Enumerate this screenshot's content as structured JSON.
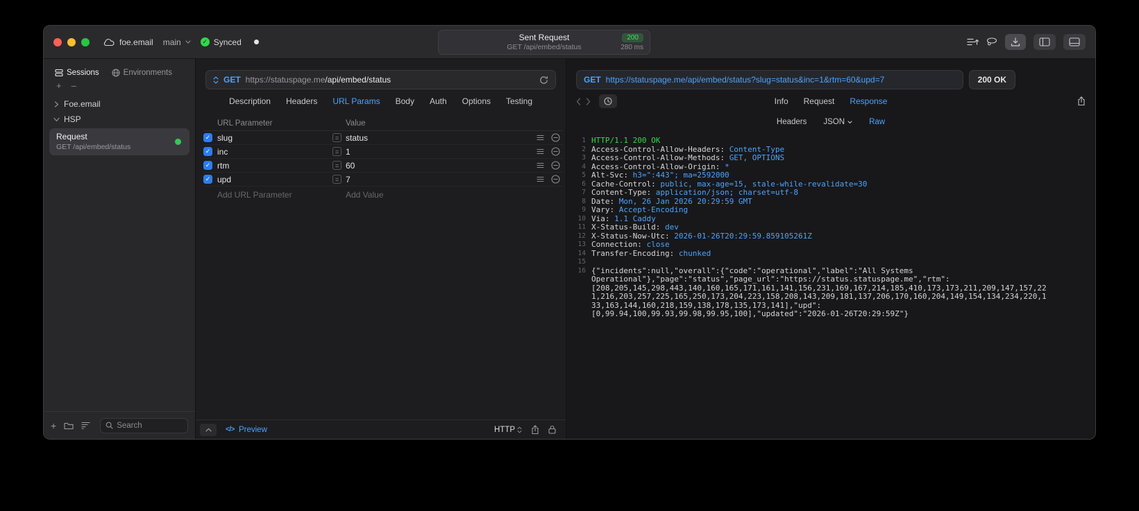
{
  "colors": {
    "accent_blue": "#4ba3ff",
    "green": "#32d74b",
    "checkbox_blue": "#2d7cf0",
    "status_dot_green": "#34c759"
  },
  "icons": {
    "plus": "+",
    "minus": "–",
    "equals": "=",
    "check": "✓",
    "code": "</>"
  },
  "titlebar": {
    "project": "foe.email",
    "branch": "main",
    "sync": "Synced",
    "center": {
      "title": "Sent Request",
      "badge": "200",
      "subtitle": "GET /api/embed/status",
      "time": "280 ms"
    }
  },
  "sidebar": {
    "tabs": [
      {
        "label": "Sessions",
        "active": true
      },
      {
        "label": "Environments",
        "active": false
      }
    ],
    "tree": [
      {
        "label": "Foe.email",
        "expanded": false
      },
      {
        "label": "HSP",
        "expanded": true
      }
    ],
    "request_item": {
      "title": "Request",
      "subtitle": "GET /api/embed/status"
    },
    "search_placeholder": "Search"
  },
  "request": {
    "method": "GET",
    "url_host": "https://statuspage.me",
    "url_path": "/api/embed/status",
    "tabs": [
      {
        "label": "Description"
      },
      {
        "label": "Headers"
      },
      {
        "label": "URL Params",
        "active": true
      },
      {
        "label": "Body"
      },
      {
        "label": "Auth"
      },
      {
        "label": "Options"
      },
      {
        "label": "Testing"
      }
    ],
    "table": {
      "col1": "URL Parameter",
      "col2": "Value",
      "rows": [
        {
          "name": "slug",
          "value": "status",
          "enabled": true
        },
        {
          "name": "inc",
          "value": "1",
          "enabled": true
        },
        {
          "name": "rtm",
          "value": "60",
          "enabled": true
        },
        {
          "name": "upd",
          "value": "7",
          "enabled": true
        }
      ],
      "add_name": "Add URL Parameter",
      "add_value": "Add Value"
    },
    "footer": {
      "preview": "Preview",
      "protocol": "HTTP"
    }
  },
  "response": {
    "method": "GET",
    "url": "https://statuspage.me/api/embed/status?slug=status&inc=1&rtm=60&upd=7",
    "status": "200 OK",
    "tabs": [
      {
        "label": "Info"
      },
      {
        "label": "Request"
      },
      {
        "label": "Response",
        "active": true
      }
    ],
    "subtabs": [
      {
        "label": "Headers"
      },
      {
        "label": "JSON",
        "chevron": true
      },
      {
        "label": "Raw",
        "active": true
      }
    ],
    "lines": [
      {
        "n": "1",
        "parts": [
          {
            "t": "HTTP/1.1 200 OK",
            "c": "g"
          }
        ]
      },
      {
        "n": "2",
        "parts": [
          {
            "t": "Access-Control-Allow-Headers: ",
            "c": "w"
          },
          {
            "t": "Content-Type",
            "c": "b"
          }
        ]
      },
      {
        "n": "3",
        "parts": [
          {
            "t": "Access-Control-Allow-Methods: ",
            "c": "w"
          },
          {
            "t": "GET, OPTIONS",
            "c": "b"
          }
        ]
      },
      {
        "n": "4",
        "parts": [
          {
            "t": "Access-Control-Allow-Origin: ",
            "c": "w"
          },
          {
            "t": "*",
            "c": "b"
          }
        ]
      },
      {
        "n": "5",
        "parts": [
          {
            "t": "Alt-Svc: ",
            "c": "w"
          },
          {
            "t": "h3=\":443\"; ma=2592000",
            "c": "b"
          }
        ]
      },
      {
        "n": "6",
        "parts": [
          {
            "t": "Cache-Control: ",
            "c": "w"
          },
          {
            "t": "public, max-age=15, stale-while-revalidate=30",
            "c": "b"
          }
        ]
      },
      {
        "n": "7",
        "parts": [
          {
            "t": "Content-Type: ",
            "c": "w"
          },
          {
            "t": "application/json; charset=utf-8",
            "c": "b"
          }
        ]
      },
      {
        "n": "8",
        "parts": [
          {
            "t": "Date: ",
            "c": "w"
          },
          {
            "t": "Mon, 26 Jan 2026 20:29:59 GMT",
            "c": "b"
          }
        ]
      },
      {
        "n": "9",
        "parts": [
          {
            "t": "Vary: ",
            "c": "w"
          },
          {
            "t": "Accept-Encoding",
            "c": "b"
          }
        ]
      },
      {
        "n": "10",
        "parts": [
          {
            "t": "Via: ",
            "c": "w"
          },
          {
            "t": "1.1 Caddy",
            "c": "b"
          }
        ]
      },
      {
        "n": "11",
        "parts": [
          {
            "t": "X-Status-Build: ",
            "c": "w"
          },
          {
            "t": "dev",
            "c": "b"
          }
        ]
      },
      {
        "n": "12",
        "parts": [
          {
            "t": "X-Status-Now-Utc: ",
            "c": "w"
          },
          {
            "t": "2026-01-26T20:29:59.859105261Z",
            "c": "b"
          }
        ]
      },
      {
        "n": "13",
        "parts": [
          {
            "t": "Connection: ",
            "c": "w"
          },
          {
            "t": "close",
            "c": "b"
          }
        ]
      },
      {
        "n": "14",
        "parts": [
          {
            "t": "Transfer-Encoding: ",
            "c": "w"
          },
          {
            "t": "chunked",
            "c": "b"
          }
        ]
      },
      {
        "n": "15",
        "parts": []
      },
      {
        "n": "16",
        "parts": [
          {
            "t": "{\"incidents\":null,\"overall\":{\"code\":\"operational\",\"label\":\"All Systems Operational\"},\"page\":\"status\",\"page_url\":\"https://status.statuspage.me\",\"rtm\":[208,205,145,298,443,140,160,165,171,161,141,156,231,169,167,214,185,410,173,173,211,209,147,157,221,216,203,257,225,165,250,173,204,223,158,208,143,209,181,137,206,170,160,204,149,154,134,234,220,133,163,144,160,218,159,138,178,135,173,141],\"upd\":[0,99.94,100,99.93,99.98,99.95,100],\"updated\":\"2026-01-26T20:29:59Z\"}",
            "c": "w"
          }
        ]
      }
    ]
  }
}
